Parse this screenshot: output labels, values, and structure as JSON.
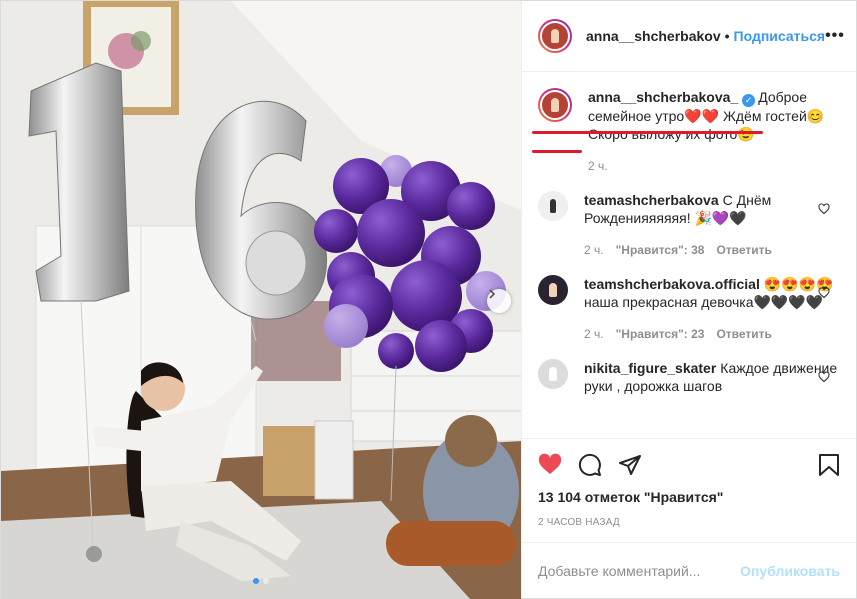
{
  "header": {
    "username": "anna__shcherbakov",
    "separator": "•",
    "follow_label": "Подписаться",
    "more_label": "•••"
  },
  "caption": {
    "username": "anna__shcherbakova_",
    "verified_mark": "✓",
    "text": "Доброе семейное утро❤️❤️ Ждём гостей😊 Скоро выложу их фото😉",
    "time": "2 ч."
  },
  "comments": [
    {
      "username": "teamashcherbakova",
      "text": "С Днём Рожденияяяяяя! 🎉💜🖤",
      "time": "2 ч.",
      "likes": "\"Нравится\": 38",
      "reply": "Ответить"
    },
    {
      "username": "teamshcherbakova.official",
      "text": "😍😍😍😍наша прекрасная девочка🖤🖤🖤🖤",
      "time": "2 ч.",
      "likes": "\"Нравится\": 23",
      "reply": "Ответить"
    },
    {
      "username": "nikita_figure_skater",
      "text": "Каждое движение руки , дорожка шагов"
    }
  ],
  "post": {
    "likes_text": "13 104 отметок \"Нравится\"",
    "time_ago": "2 ЧАСОВ НАЗАД",
    "comment_placeholder": "Добавьте комментарий...",
    "publish_label": "Опубликовать"
  },
  "carousel": {
    "current": 1,
    "total": 2
  },
  "colors": {
    "link_blue": "#3897f0",
    "like_red": "#ed4956",
    "underline_red": "#e01a2c",
    "balloon_purple": "#5b2a9e"
  },
  "icons": [
    "heart-icon",
    "comment-icon",
    "share-icon",
    "save-icon",
    "chevron-right-icon",
    "more-icon"
  ]
}
